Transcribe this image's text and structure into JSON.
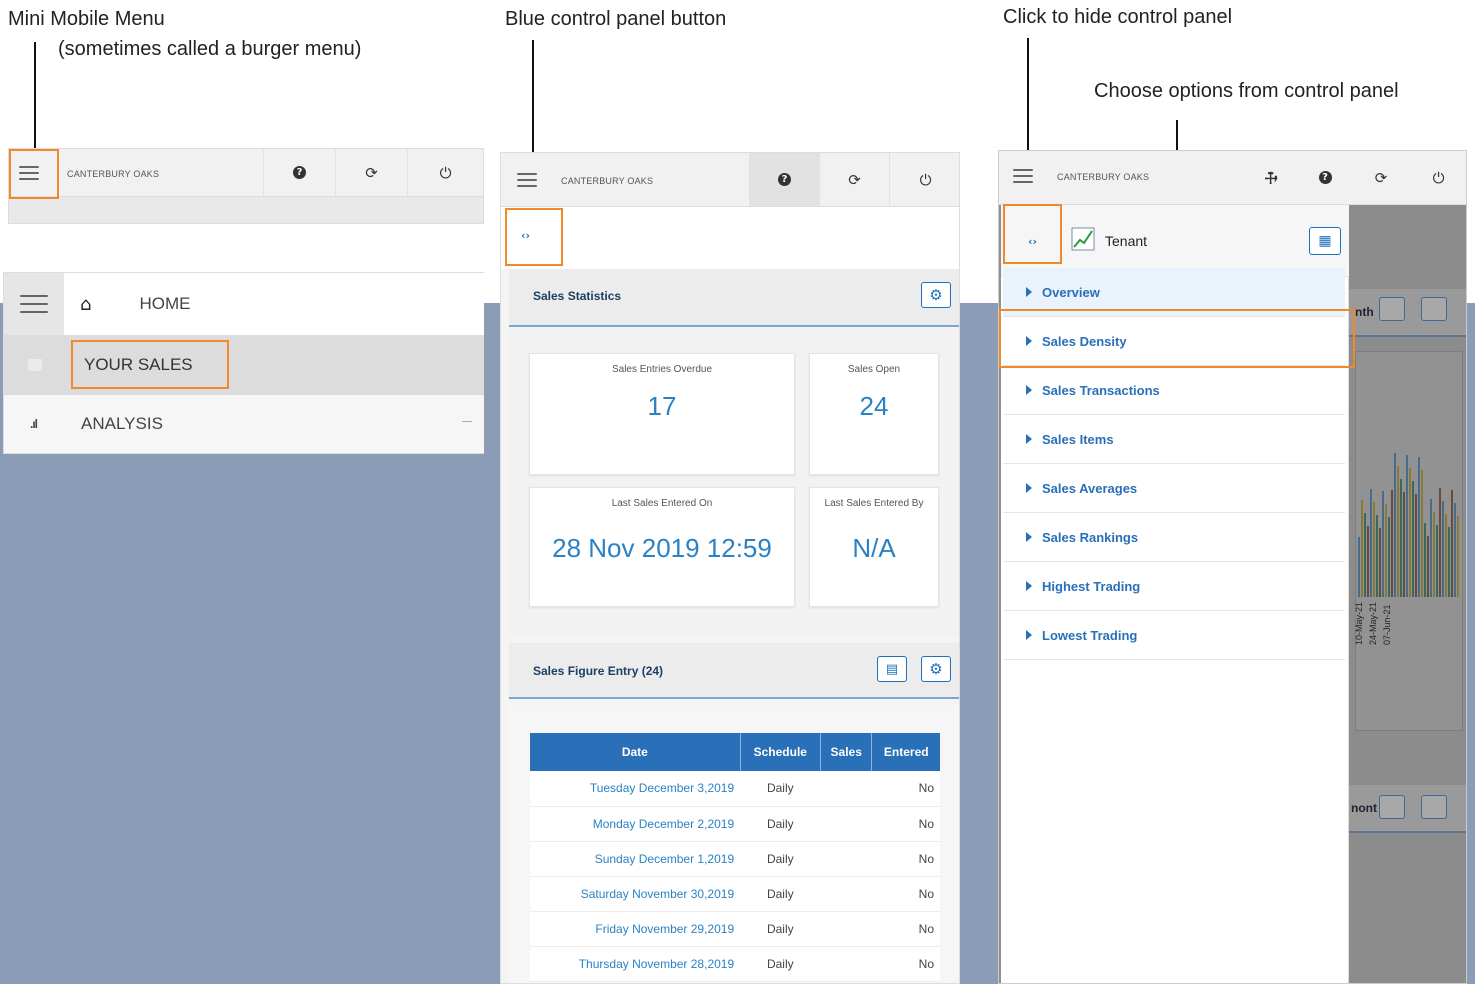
{
  "callouts": {
    "burger_title": "Mini Mobile Menu",
    "burger_sub": "(sometimes called a burger menu)",
    "blue_button": "Blue control panel button",
    "hide_panel": "Click to hide control panel",
    "choose_options": "Choose options from control panel"
  },
  "brand": "CANTERBURY OAKS",
  "menu": {
    "home": "HOME",
    "your_sales": "YOUR SALES",
    "analysis": "ANALYSIS"
  },
  "sales_statistics": {
    "title": "Sales Statistics",
    "entries_overdue_label": "Sales Entries Overdue",
    "entries_overdue_value": "17",
    "sales_open_label": "Sales Open",
    "sales_open_value": "24",
    "last_entered_on_label": "Last Sales Entered On",
    "last_entered_on_value": "28 Nov 2019 12:59",
    "last_entered_by_label": "Last Sales Entered By",
    "last_entered_by_value": "N/A"
  },
  "sales_figure_entry": {
    "title": "Sales Figure Entry (24)",
    "columns": [
      "Date",
      "Schedule",
      "Sales",
      "Entered"
    ],
    "rows": [
      {
        "date": "Tuesday December 3,2019",
        "schedule": "Daily",
        "sales": "",
        "entered": "No"
      },
      {
        "date": "Monday December 2,2019",
        "schedule": "Daily",
        "sales": "",
        "entered": "No"
      },
      {
        "date": "Sunday December 1,2019",
        "schedule": "Daily",
        "sales": "",
        "entered": "No"
      },
      {
        "date": "Saturday November 30,2019",
        "schedule": "Daily",
        "sales": "",
        "entered": "No"
      },
      {
        "date": "Friday November 29,2019",
        "schedule": "Daily",
        "sales": "",
        "entered": "No"
      },
      {
        "date": "Thursday November 28,2019",
        "schedule": "Daily",
        "sales": "",
        "entered": "No"
      }
    ]
  },
  "control_panel": {
    "title": "Tenant",
    "items": [
      "Overview",
      "Sales Density",
      "Sales Transactions",
      "Sales Items",
      "Sales Averages",
      "Sales Rankings",
      "Highest Trading",
      "Lowest Trading"
    ]
  },
  "background_chart": {
    "header_fragment_1": "nth",
    "header_fragment_2": "nont",
    "dates": [
      "10-May-21",
      "24-May-21",
      "07-Jun-21"
    ]
  },
  "colors": {
    "accent_blue": "#2a70b8",
    "link_blue": "#2a82c4",
    "highlight_orange": "#ef8a2a",
    "background_slate": "#8a9cb6"
  }
}
